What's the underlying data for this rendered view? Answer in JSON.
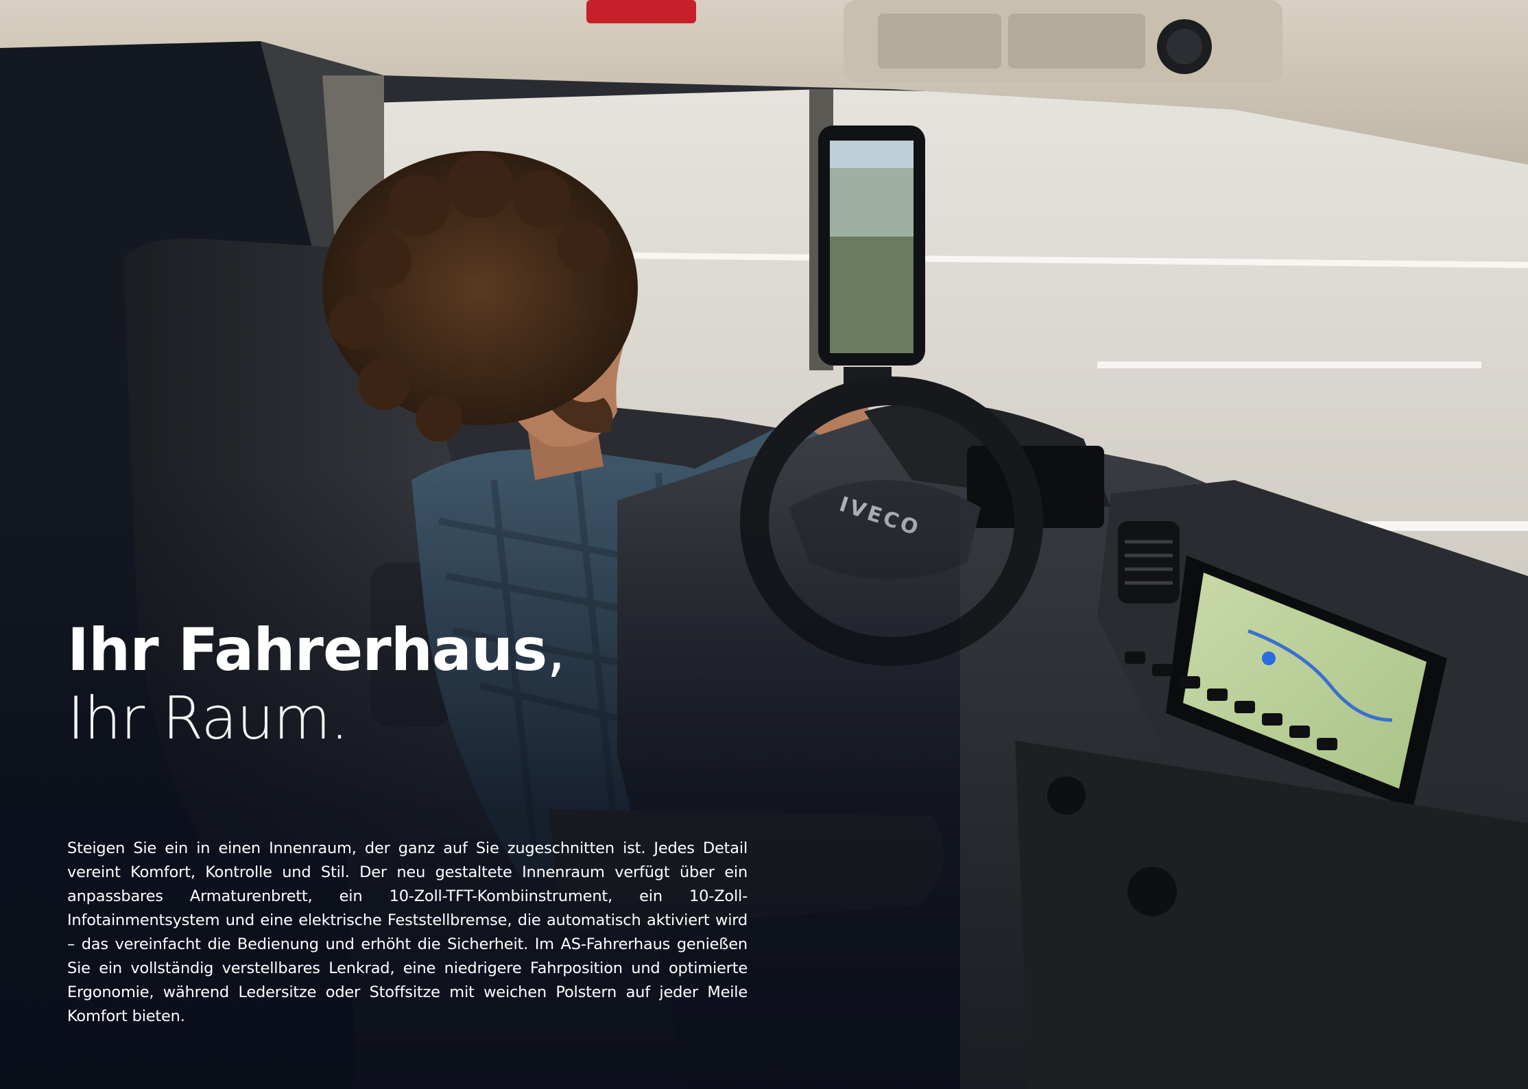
{
  "headline": {
    "line1": "Ihr Fahrerhaus",
    "comma": ",",
    "line2": "Ihr Raum."
  },
  "body": "Steigen Sie ein in einen Innenraum, der ganz auf Sie zugeschnitten ist. Jedes Detail vereint Komfort, Kontrolle und Stil. Der neu gestaltete Innenraum verfügt über ein anpassbares Armaturenbrett, ein 10-Zoll-TFT-Kombiinstrument, ein 10-Zoll-Infotainmentsystem und eine elektrische Feststellbremse, die automatisch aktiviert wird – das vereinfacht die Bedienung und erhöht die Sicherheit. Im AS-Fahrerhaus genießen Sie ein vollständig verstellbares Lenkrad, eine niedrigere Fahrposition und optimierte Ergonomie, während Ledersitze oder Stoffsitze mit weichen Polstern auf jeder Meile Komfort bieten.",
  "photo": {
    "steering_logo": "IVECO",
    "colors": {
      "road": "#d9d6cf",
      "cab_ceiling": "#cfc7b8",
      "dashboard": "#2a2d33",
      "shirt": "#3d5567",
      "overlay": "#0a0e1a"
    }
  }
}
